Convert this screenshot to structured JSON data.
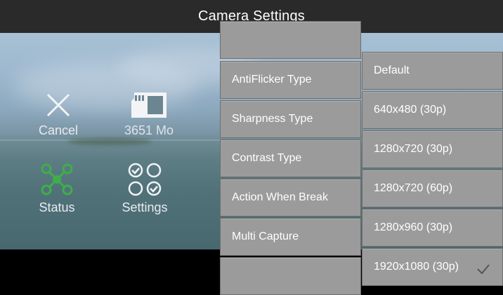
{
  "window": {
    "title": "Camera Settings"
  },
  "controls": {
    "cancel": {
      "label": "Cancel"
    },
    "storage": {
      "label": "3651 Mo"
    },
    "status": {
      "label": "Status"
    },
    "settings": {
      "label": "Settings"
    }
  },
  "settings_menu": {
    "items": [
      {
        "label": ""
      },
      {
        "label": "AntiFlicker Type"
      },
      {
        "label": "Sharpness Type"
      },
      {
        "label": "Contrast Type"
      },
      {
        "label": "Action When Break"
      },
      {
        "label": "Multi Capture"
      },
      {
        "label": ""
      }
    ]
  },
  "resolution_menu": {
    "items": [
      {
        "label": "Default"
      },
      {
        "label": "640x480 (30p)"
      },
      {
        "label": "1280x720 (30p)"
      },
      {
        "label": "1280x720 (60p)"
      },
      {
        "label": "1280x960 (30p)"
      },
      {
        "label": "1920x1080 (30p)"
      }
    ],
    "selected": "1920x1080 (30p)"
  },
  "colors": {
    "titlebar": "#2a2a2a",
    "menu_item": "#9b9b9b",
    "status_icon": "#3fae4a",
    "text": "#ffffff"
  }
}
